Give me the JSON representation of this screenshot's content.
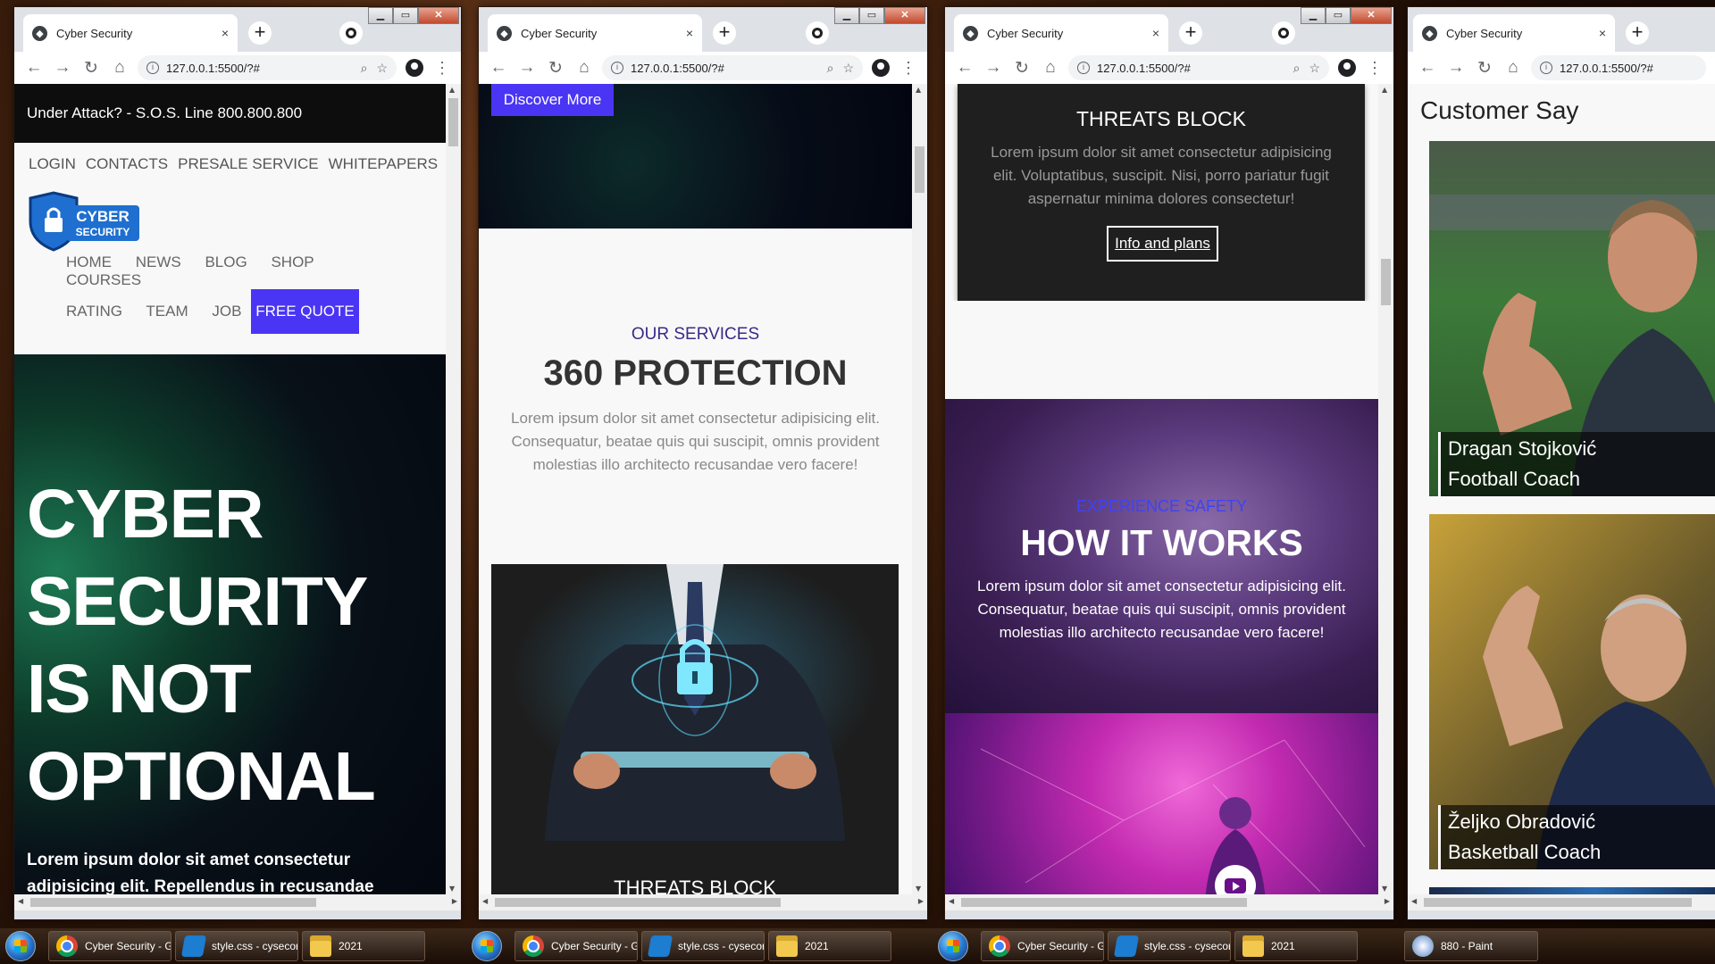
{
  "browser": {
    "tab_title": "Cyber Security",
    "url": "127.0.0.1:5500/?#",
    "new_tab": "+",
    "close_tab": "×",
    "window_controls": {
      "minimize": "▁",
      "maximize": "▭",
      "close": "✕"
    }
  },
  "window1": {
    "topbar_text": "Under Attack? - S.O.S. Line 800.800.800",
    "top_menu": [
      "LOGIN",
      "CONTACTS",
      "PRESALE SERVICE",
      "WHITEPAPERS"
    ],
    "logo": {
      "line1": "CYBER",
      "line2": "SECURITY"
    },
    "nav_row1": [
      "HOME",
      "NEWS",
      "BLOG",
      "SHOP",
      "COURSES"
    ],
    "nav_row2": [
      "RATING",
      "TEAM",
      "JOB"
    ],
    "free_quote": "FREE QUOTE",
    "hero_title": [
      "CYBER",
      "SECURITY",
      "IS NOT",
      "OPTIONAL"
    ],
    "hero_text": "Lorem ipsum dolor sit amet consectetur adipisicing elit. Repellendus in recusandae itaque, vel similique maxime magni tenetur"
  },
  "window2": {
    "discover": "Discover More",
    "services_label": "OUR SERVICES",
    "services_title": "360 PROTECTION",
    "services_text": "Lorem ipsum dolor sit amet consectetur adipisicing elit. Consequatur, beatae quis qui suscipit, omnis provident molestias illo architecto recusandae vero facere!",
    "card_title": "THREATS BLOCK"
  },
  "window3": {
    "threats_title": "THREATS BLOCK",
    "threats_text": "Lorem ipsum dolor sit amet consectetur adipisicing elit. Voluptatibus, suscipit. Nisi, porro pariatur fugit aspernatur minima dolores consectetur!",
    "info_button": "Info and plans",
    "how_label": "EXPERIENCE SAFETY",
    "how_title": "HOW IT WORKS",
    "how_text": "Lorem ipsum dolor sit amet consectetur adipisicing elit. Consequatur, beatae quis qui suscipit, omnis provident molestias illo architecto recusandae vero facere!"
  },
  "window4": {
    "section_title": "Customer Say",
    "testimonials": [
      {
        "name": "Dragan Stojković",
        "role": "Football Coach"
      },
      {
        "name": "Željko Obradović",
        "role": "Basketball Coach"
      }
    ]
  },
  "taskbar": {
    "group1": [
      "Cyber Security - G...",
      "style.css - cysecor...",
      "2021"
    ],
    "group2": [
      "Cyber Security - G...",
      "style.css - cysecor...",
      "2021"
    ],
    "group3": [
      "Cyber Security - G...",
      "style.css - cysecor...",
      "2021"
    ],
    "group4": [
      "880 - Paint"
    ]
  },
  "colors": {
    "accent": "#4a35f5",
    "dark": "#1f1f1f",
    "how_label": "#3e43f6"
  }
}
